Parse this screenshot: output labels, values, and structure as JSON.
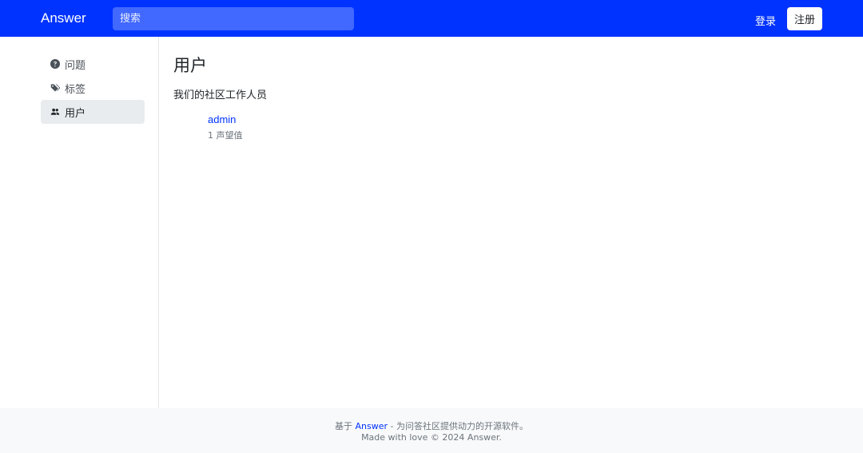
{
  "navbar": {
    "brand": "Answer",
    "search_placeholder": "搜索",
    "login_label": "登录",
    "signup_label": "注册"
  },
  "sidebar": {
    "items": [
      {
        "label": "问题",
        "icon": "question-circle-icon",
        "active": false
      },
      {
        "label": "标签",
        "icon": "tags-icon",
        "active": false
      },
      {
        "label": "用户",
        "icon": "people-icon",
        "active": true
      }
    ]
  },
  "main": {
    "title": "用户",
    "description": "我们的社区工作人员",
    "staff": [
      {
        "name": "admin",
        "reputation": "1 声望值"
      }
    ]
  },
  "footer": {
    "prefix": "基于 ",
    "link_text": "Answer",
    "suffix": " - 为问答社区提供动力的开源软件。",
    "line2": "Made with love © 2024 Answer."
  },
  "colors": {
    "brand_blue": "#0033ff",
    "search_bg": "#4168ff",
    "active_bg": "#e9ecef",
    "footer_bg": "#f8f9fa"
  }
}
